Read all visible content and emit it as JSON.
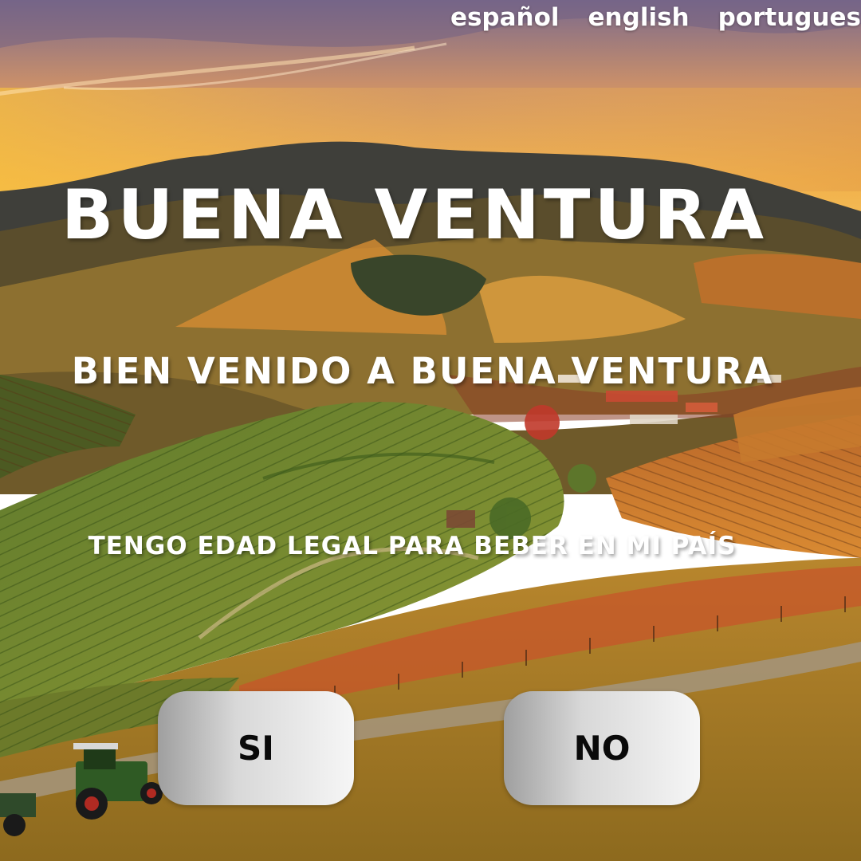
{
  "languages": [
    "español",
    "english",
    "portugues"
  ],
  "brand": {
    "name": "BUENA VENTURA"
  },
  "welcome": "BIEN VENIDO A BUENA VENTURA",
  "age_question": "TENGO EDAD LEGAL PARA BEBER EN MI PAÍS",
  "buttons": {
    "yes": "SI",
    "no": "NO"
  },
  "colors": {
    "text": "#ffffff",
    "button_text": "#0a0a0a",
    "button_light": "#f6f6f6",
    "button_dark": "#9f9f9f"
  }
}
